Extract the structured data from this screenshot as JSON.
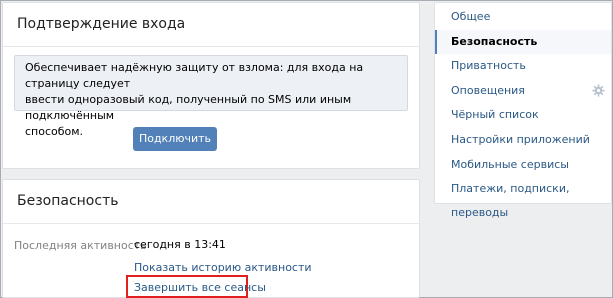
{
  "login_confirm": {
    "title": "Подтверждение входа",
    "notice_line1": "Обеспечивает надёжную защиту от взлома: для входа на страницу следует",
    "notice_line2": "ввести одноразовый код, полученный по SMS или иным подключённым",
    "notice_line3": "способом.",
    "connect_button": "Подключить"
  },
  "security": {
    "title": "Безопасность",
    "last_activity_label": "Последняя активность",
    "last_activity_value": "сегодня в 13:41",
    "show_history_link": "Показать историю активности",
    "end_all_sessions_link": "Завершить все сеансы"
  },
  "menu": {
    "items": [
      {
        "label": "Общее"
      },
      {
        "label": "Безопасность"
      },
      {
        "label": "Приватность"
      },
      {
        "label": "Оповещения"
      },
      {
        "label": "Чёрный список"
      },
      {
        "label": "Настройки приложений"
      },
      {
        "label": "Мобильные сервисы"
      },
      {
        "label": "Платежи, подписки, переводы"
      }
    ],
    "active_index": 1
  },
  "colors": {
    "accent": "#5181b8",
    "link": "#2a5885",
    "highlight": "#e0201c"
  },
  "icons": {
    "notifications_settings": "gear-icon"
  }
}
